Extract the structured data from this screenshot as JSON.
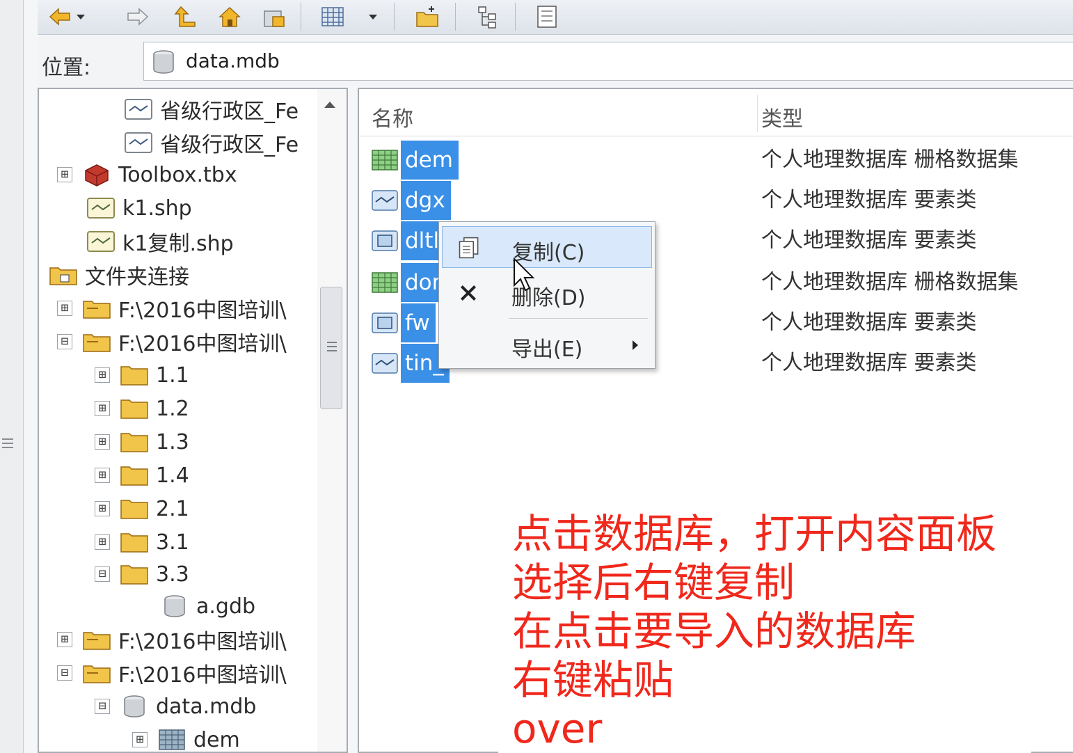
{
  "toolbar": {
    "buttons": [
      "back-icon",
      "back-dropdown-icon",
      "forward-icon",
      "up-one-level-icon",
      "home-icon",
      "folder-connection-icon",
      "view-options-icon",
      "view-dropdown-icon",
      "new-folder-icon",
      "tree-view-icon",
      "list-view-icon"
    ]
  },
  "location": {
    "label": "位置:",
    "value": "data.mdb"
  },
  "tree": {
    "items": [
      {
        "label": "省级行政区_Fe",
        "icon": "line-feature-icon"
      },
      {
        "label": "省级行政区_Fe",
        "icon": "line-feature-icon"
      },
      {
        "label": "Toolbox.tbx",
        "icon": "toolbox-icon",
        "expander": "⊞"
      },
      {
        "label": "k1.shp",
        "icon": "shapefile-icon"
      },
      {
        "label": "k1复制.shp",
        "icon": "shapefile-icon"
      },
      {
        "label": "文件夹连接",
        "icon": "folder-connections-icon"
      },
      {
        "label": "F:\\2016中图培训\\",
        "icon": "folder-connection-icon",
        "expander": "⊞"
      },
      {
        "label": "F:\\2016中图培训\\",
        "icon": "folder-connection-icon",
        "expander": "⊟"
      },
      {
        "label": "1.1",
        "icon": "folder-icon",
        "expander": "⊞"
      },
      {
        "label": "1.2",
        "icon": "folder-icon",
        "expander": "⊞"
      },
      {
        "label": "1.3",
        "icon": "folder-icon",
        "expander": "⊞"
      },
      {
        "label": "1.4",
        "icon": "folder-icon",
        "expander": "⊞"
      },
      {
        "label": "2.1",
        "icon": "folder-icon",
        "expander": "⊞"
      },
      {
        "label": "3.1",
        "icon": "folder-icon",
        "expander": "⊞"
      },
      {
        "label": "3.3",
        "icon": "folder-icon",
        "expander": "⊟"
      },
      {
        "label": "a.gdb",
        "icon": "database-icon"
      },
      {
        "label": "F:\\2016中图培训\\",
        "icon": "folder-connection-icon",
        "expander": "⊞"
      },
      {
        "label": "F:\\2016中图培训\\",
        "icon": "folder-connection-icon",
        "expander": "⊟"
      },
      {
        "label": "data.mdb",
        "icon": "database-icon",
        "expander": "⊟"
      },
      {
        "label": "dem",
        "icon": "raster-icon",
        "expander": "⊞"
      }
    ]
  },
  "content": {
    "columns": {
      "name": "名称",
      "type": "类型"
    },
    "rows": [
      {
        "name": "dem",
        "type": "个人地理数据库 栅格数据集",
        "icon": "raster-icon"
      },
      {
        "name": "dgx",
        "type": "个人地理数据库 要素类",
        "icon": "line-feature-icon"
      },
      {
        "name": "dltl",
        "type": "个人地理数据库 要素类",
        "icon": "polygon-feature-icon"
      },
      {
        "name": "dom",
        "type": "个人地理数据库 栅格数据集",
        "icon": "raster-icon"
      },
      {
        "name": "fw",
        "type": "个人地理数据库 要素类",
        "icon": "polygon-feature-icon"
      },
      {
        "name": "tin_",
        "type": "个人地理数据库 要素类",
        "icon": "line-feature-icon"
      }
    ]
  },
  "context_menu": {
    "copy": "复制(C)",
    "delete": "删除(D)",
    "export": "导出(E)"
  },
  "annotation": {
    "lines": [
      "点击数据库，打开内容面板",
      "选择后右键复制",
      "在点击要导入的数据库",
      "右键粘贴",
      "over"
    ],
    "color": "#f0281c"
  },
  "colors": {
    "selection": "#3a8fe6",
    "menu_highlight": "#d9e9fb"
  }
}
